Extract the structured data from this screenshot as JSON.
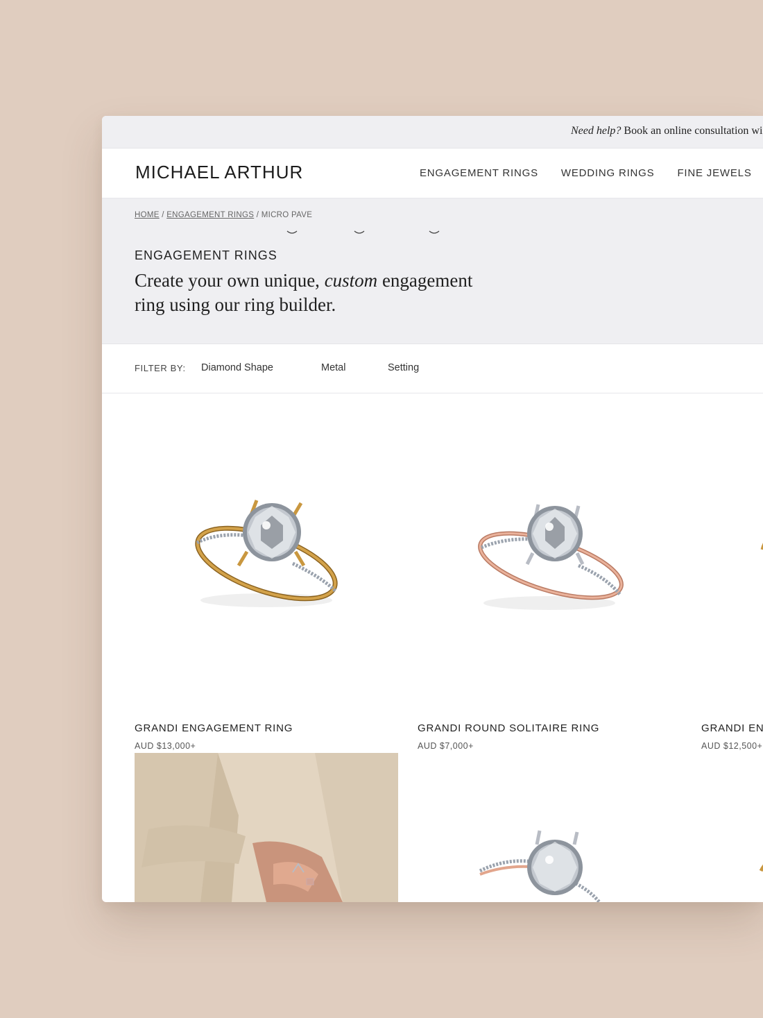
{
  "topbar": {
    "help_label": "Need help?",
    "help_text": " Book an online consultation wi"
  },
  "header": {
    "logo": "MICHAEL ARTHUR",
    "nav": [
      "ENGAGEMENT RINGS",
      "WEDDING RINGS",
      "FINE JEWELS"
    ]
  },
  "breadcrumb": {
    "home": "HOME",
    "category": "ENGAGEMENT RINGS",
    "current": "MICRO PAVE",
    "separator": " / "
  },
  "hero": {
    "kicker": "ENGAGEMENT RINGS",
    "title_pre": "Create your own unique, ",
    "title_em": "custom",
    "title_post": " engagement ring using our ring builder."
  },
  "filters": {
    "label": "FILTER BY:",
    "options": [
      "Diamond Shape",
      "Metal",
      "Setting"
    ]
  },
  "products": [
    {
      "name": "GRANDI ENGAGEMENT RING",
      "price": "AUD $13,000+",
      "metal": "yellow-gold"
    },
    {
      "name": "GRANDI ROUND SOLITAIRE RING",
      "price": "AUD $7,000+",
      "metal": "rose-gold"
    },
    {
      "name": "GRANDI EN",
      "price": "AUD $12,500+",
      "metal": "yellow-gold"
    }
  ],
  "colors": {
    "page_bg": "#e0cdbf",
    "panel_bg": "#efeff2",
    "yellow_gold": "#c9973f",
    "rose_gold": "#e2a58c",
    "platinum": "#b8bcc4"
  }
}
